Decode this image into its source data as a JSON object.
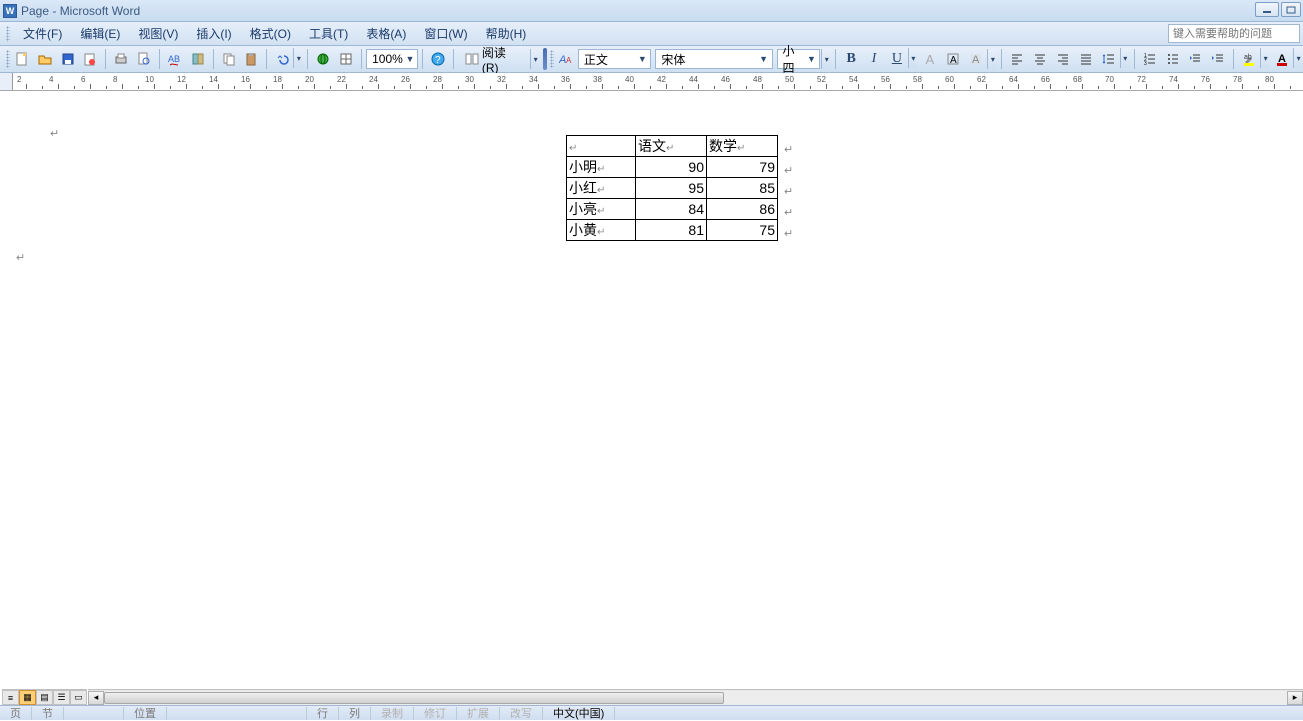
{
  "title": "Page - Microsoft Word",
  "menu": {
    "file": "文件(F)",
    "edit": "编辑(E)",
    "view": "视图(V)",
    "insert": "插入(I)",
    "format": "格式(O)",
    "tools": "工具(T)",
    "table": "表格(A)",
    "window": "窗口(W)",
    "help": "帮助(H)"
  },
  "helpbox_placeholder": "键入需要帮助的问题",
  "toolbar1": {
    "zoom": "100%",
    "read_label": "阅读(R)"
  },
  "toolbar2": {
    "style": "正文",
    "font": "宋体",
    "size": "小四"
  },
  "ruler_numbers": [
    2,
    4,
    6,
    8,
    10,
    12,
    14,
    16,
    18,
    20,
    22,
    24,
    26,
    28,
    30,
    32,
    34,
    36,
    38,
    40,
    42,
    44,
    46,
    48,
    50,
    52,
    54,
    56,
    58,
    60,
    62,
    64,
    66,
    68,
    70,
    72,
    74,
    76,
    78,
    80
  ],
  "table": {
    "headers": [
      "",
      "语文",
      "数学"
    ],
    "rows": [
      {
        "name": "小明",
        "yuwen": 90,
        "shuxue": 79
      },
      {
        "name": "小红",
        "yuwen": 95,
        "shuxue": 85
      },
      {
        "name": "小亮",
        "yuwen": 84,
        "shuxue": 86
      },
      {
        "name": "小黄",
        "yuwen": 81,
        "shuxue": 75
      }
    ]
  },
  "status": {
    "page": "页",
    "section": "节",
    "position": "位置",
    "line": "行",
    "column": "列",
    "rec": "录制",
    "rev": "修订",
    "ext": "扩展",
    "ovr": "改写",
    "lang": "中文(中国)"
  }
}
